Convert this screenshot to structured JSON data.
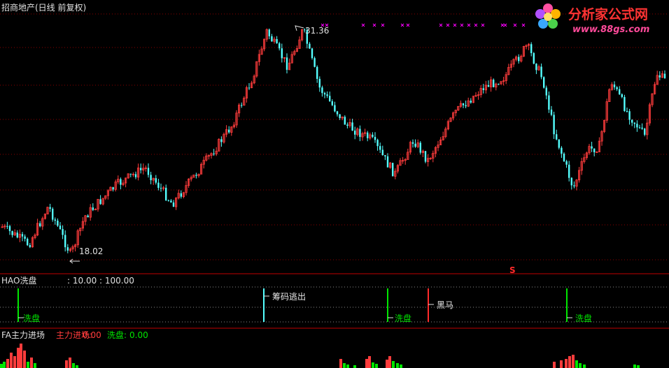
{
  "title": "招商地产(日线 前复权)",
  "logo": {
    "name": "分析家公式网",
    "url": "www.88gs.com"
  },
  "main_chart": {
    "high_label": "31.36",
    "low_label": "18.02",
    "s_marker": "S"
  },
  "hao_panel": {
    "name": "HAO洗盘",
    "params": ": 10.00 : 100.00",
    "labels": [
      "洗盘",
      "筹码逃出",
      "洗盘",
      "黑马",
      "洗盘"
    ]
  },
  "fa_panel": {
    "name": "FA主力进场",
    "series": [
      {
        "label": "主力进场:",
        "value": "0.00"
      },
      {
        "label": "洗盘:",
        "value": "0.00"
      }
    ]
  },
  "colors": {
    "up": "#ff3c3c",
    "down": "#54ffff",
    "grid": "#8b0000",
    "green": "#00e600",
    "magenta": "#ff00ff",
    "panel_line": "#c00000"
  },
  "chart_data": {
    "type": "candlestick",
    "title": "招商地产(日线 前复权)",
    "max_price": 31.36,
    "min_price": 18.02
  }
}
